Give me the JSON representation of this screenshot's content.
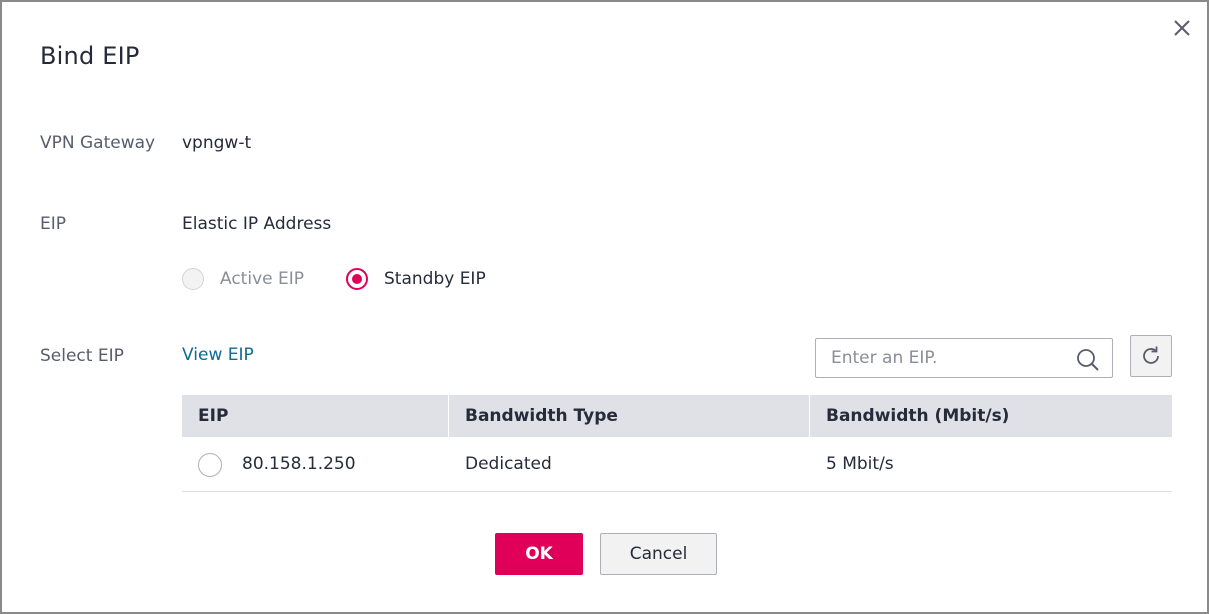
{
  "dialog": {
    "title": "Bind EIP",
    "close_icon": "close-icon"
  },
  "vpn_gateway": {
    "label": "VPN Gateway",
    "value": "vpngw-t"
  },
  "eip": {
    "label": "EIP",
    "value": "Elastic IP Address",
    "options": [
      {
        "label": "Active EIP",
        "state": "disabled"
      },
      {
        "label": "Standby EIP",
        "state": "selected"
      }
    ]
  },
  "select_eip": {
    "label": "Select EIP",
    "view_link": "View EIP",
    "search": {
      "placeholder": "Enter an EIP.",
      "value": "",
      "icon": "search-icon"
    },
    "refresh_icon": "refresh-icon"
  },
  "table": {
    "columns": [
      "EIP",
      "Bandwidth Type",
      "Bandwidth (Mbit/s)"
    ],
    "rows": [
      {
        "eip": "80.158.1.250",
        "bandwidth_type": "Dedicated",
        "bandwidth": "5 Mbit/s",
        "selected": false
      }
    ]
  },
  "footer": {
    "ok_label": "OK",
    "cancel_label": "Cancel"
  },
  "colors": {
    "accent": "#e0005a",
    "link": "#0e6a96",
    "table_header_bg": "#dfe1e6"
  }
}
